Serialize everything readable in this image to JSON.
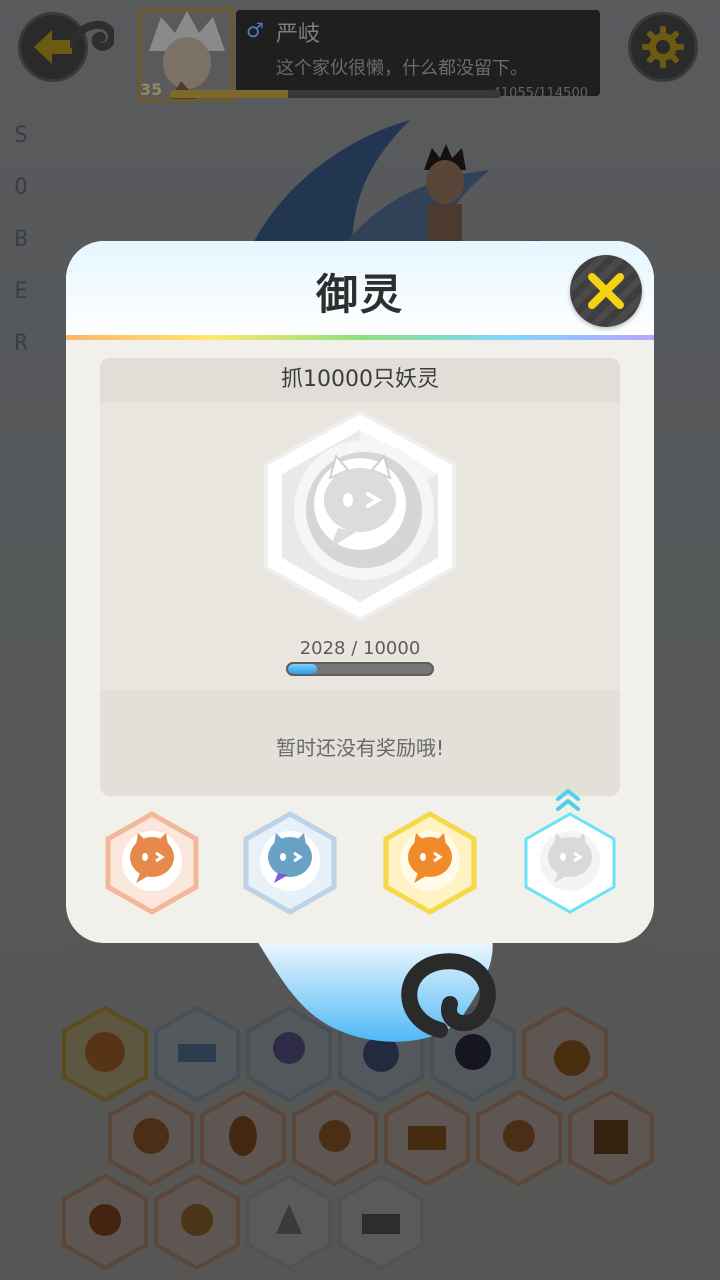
{
  "player": {
    "gender_symbol": "♂",
    "name": "严岐",
    "signature": "这个家伙很懒，什么都没留下。",
    "level": "35",
    "xp_text": "41055/114500",
    "xp_fraction": 0.358
  },
  "background": {
    "side_letters": [
      "S",
      "O",
      "B",
      "E",
      "R"
    ]
  },
  "dialog": {
    "title": "御灵",
    "achievement": {
      "task": "抓10000只妖灵",
      "progress_text": "2028 / 10000",
      "current": 2028,
      "target": 10000,
      "reward_text": "暂时还没有奖励哦!"
    },
    "tiers": [
      {
        "name": "bronze",
        "color": "#e58a4a",
        "rim": "#f3b899",
        "state": "unlocked"
      },
      {
        "name": "silver",
        "color": "#6aa2c6",
        "rim": "#bcd3e6",
        "state": "unlocked"
      },
      {
        "name": "gold",
        "color": "#f08a2a",
        "rim": "#f6d94a",
        "state": "unlocked"
      },
      {
        "name": "platinum",
        "color": "#d9d9d9",
        "rim": "#69e3f5",
        "state": "selected"
      }
    ]
  },
  "colors": {
    "accent_yellow": "#f4d312",
    "progress_blue": "#2f9be6"
  }
}
